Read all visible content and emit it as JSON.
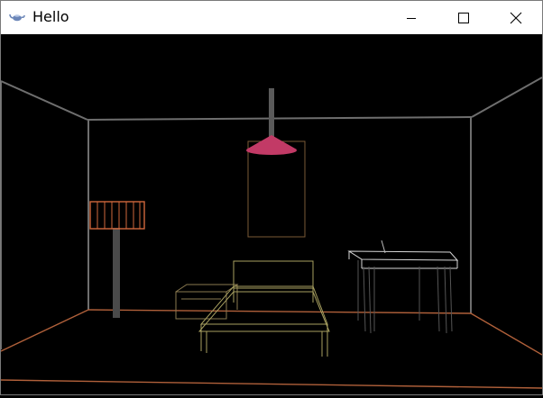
{
  "window": {
    "title": "Hello",
    "app_icon": "teapot-icon",
    "controls": {
      "minimize": "minimize-icon",
      "maximize": "maximize-icon",
      "close": "close-icon"
    }
  },
  "scene": {
    "render_mode": "wireframe",
    "objects": [
      "room",
      "ceiling-lamp",
      "floor-lamp",
      "bed",
      "nightstand",
      "desk",
      "picture-frame"
    ],
    "colors": {
      "background": "#000000",
      "walls": "#6e6e6e",
      "floor_edge": "#b0603a",
      "ceiling_lamp_shade": "#c23a66",
      "lamp_pole": "#5a5a5a",
      "floor_lamp_shade": "#d0683c",
      "bed": "#a8a060",
      "desk": "#d8d8d8",
      "frame": "#7a5a36"
    }
  }
}
